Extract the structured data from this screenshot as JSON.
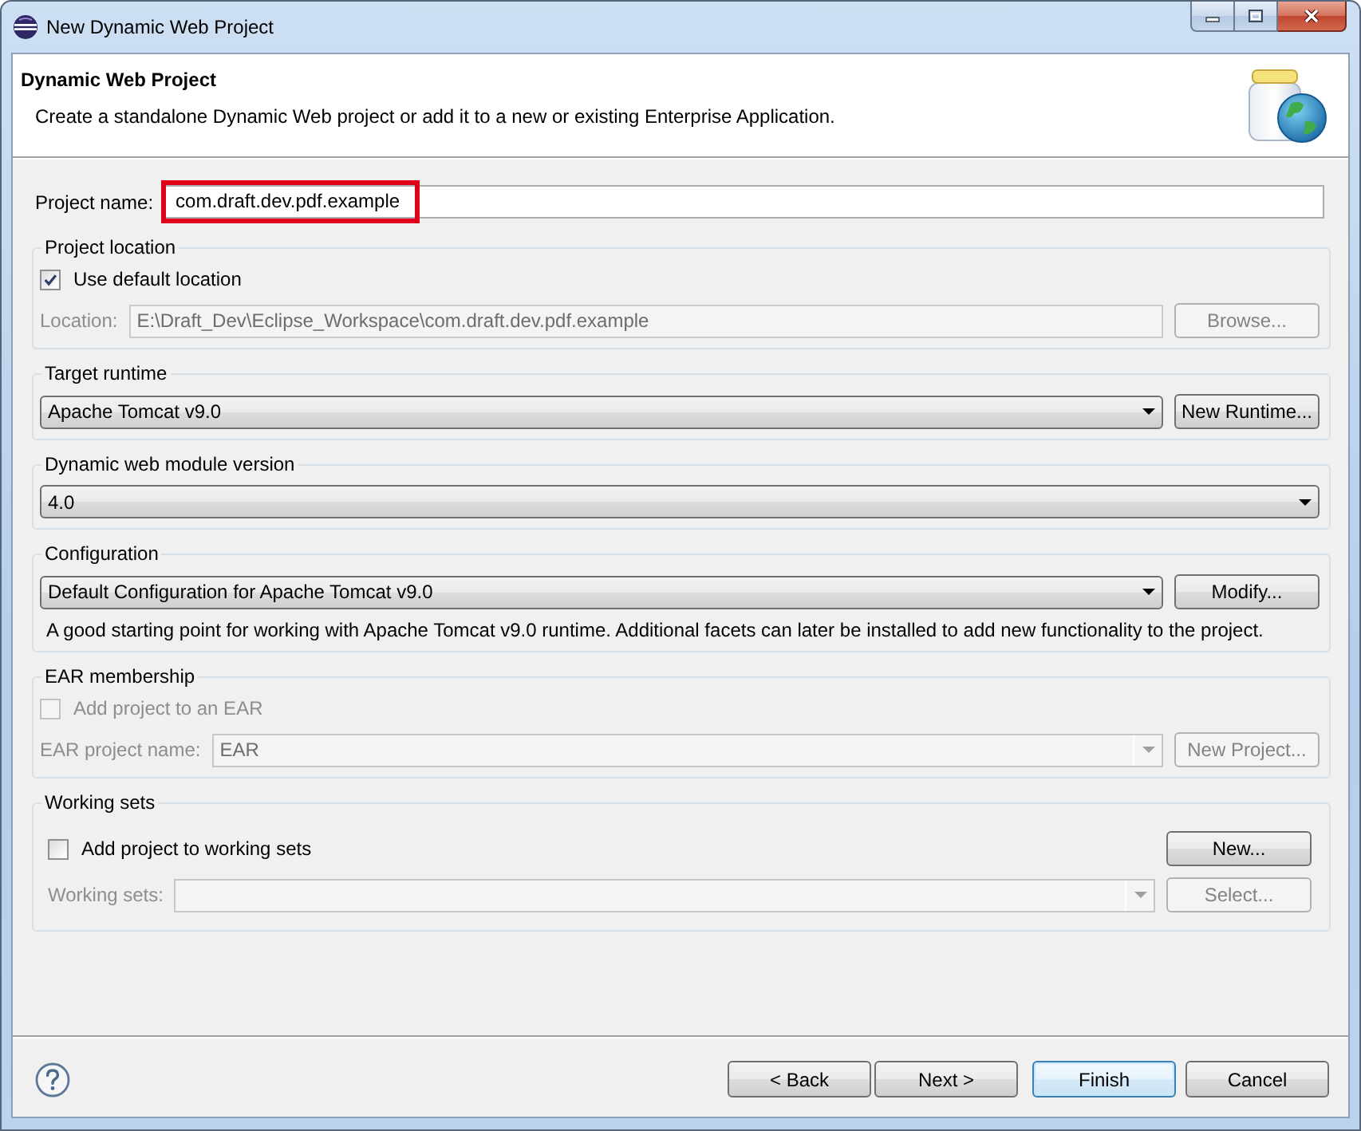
{
  "window": {
    "title": "New Dynamic Web Project"
  },
  "header": {
    "title": "Dynamic Web Project",
    "description": "Create a standalone Dynamic Web project or add it to a new or existing Enterprise Application."
  },
  "project_name": {
    "label": "Project name:",
    "value": "com.draft.dev.pdf.example",
    "highlighted": true
  },
  "groups": [
    {
      "title": "Project location",
      "rows": [
        {
          "items": [
            {
              "kind": "checkbox",
              "label": "Use default location",
              "checked": true,
              "disabled": false
            }
          ]
        },
        {
          "items": [
            {
              "kind": "label",
              "text": "Location:",
              "disabled": true
            },
            {
              "kind": "field",
              "value": "E:\\Draft_Dev\\Eclipse_Workspace\\com.draft.dev.pdf.example",
              "disabled": true
            },
            {
              "kind": "button",
              "label": "Browse...",
              "disabled": true
            }
          ]
        }
      ]
    },
    {
      "title": "Target runtime",
      "rows": [
        {
          "items": [
            {
              "kind": "dropdown",
              "value": "Apache Tomcat v9.0",
              "disabled": false
            },
            {
              "kind": "button",
              "label": "New Runtime...",
              "disabled": false
            }
          ]
        }
      ]
    },
    {
      "title": "Dynamic web module version",
      "rows": [
        {
          "items": [
            {
              "kind": "dropdown",
              "value": "4.0",
              "disabled": false
            }
          ]
        }
      ]
    },
    {
      "title": "Configuration",
      "rows": [
        {
          "items": [
            {
              "kind": "dropdown",
              "value": "Default Configuration for Apache Tomcat v9.0",
              "disabled": false
            },
            {
              "kind": "button",
              "label": "Modify...",
              "disabled": false
            }
          ]
        },
        {
          "items": [
            {
              "kind": "text",
              "text": "A good starting point for working with Apache Tomcat v9.0 runtime. Additional facets can later be installed to add new functionality to the project."
            }
          ]
        }
      ]
    },
    {
      "title": "EAR membership",
      "rows": [
        {
          "items": [
            {
              "kind": "checkbox",
              "label": "Add project to an EAR",
              "checked": false,
              "disabled": true
            }
          ]
        },
        {
          "items": [
            {
              "kind": "label",
              "text": "EAR project name:",
              "disabled": true
            },
            {
              "kind": "dropdown",
              "value": "EAR",
              "disabled": true
            },
            {
              "kind": "button",
              "label": "New Project...",
              "disabled": true
            }
          ]
        }
      ]
    },
    {
      "title": "Working sets",
      "rows": [
        {
          "items": [
            {
              "kind": "checkbox",
              "label": "Add project to working sets",
              "checked": false,
              "disabled": false
            },
            {
              "kind": "button",
              "label": "New...",
              "disabled": false
            }
          ]
        },
        {
          "items": [
            {
              "kind": "label",
              "text": "Working sets:",
              "disabled": true
            },
            {
              "kind": "dropdown",
              "disabled": true
            },
            {
              "kind": "button",
              "label": "Select...",
              "disabled": true
            }
          ]
        }
      ]
    }
  ],
  "buttons": [
    {
      "label": "< Back",
      "default": false
    },
    {
      "label": "Next >",
      "default": false
    },
    {
      "label": "Finish",
      "default": true
    },
    {
      "label": "Cancel",
      "default": false
    }
  ]
}
